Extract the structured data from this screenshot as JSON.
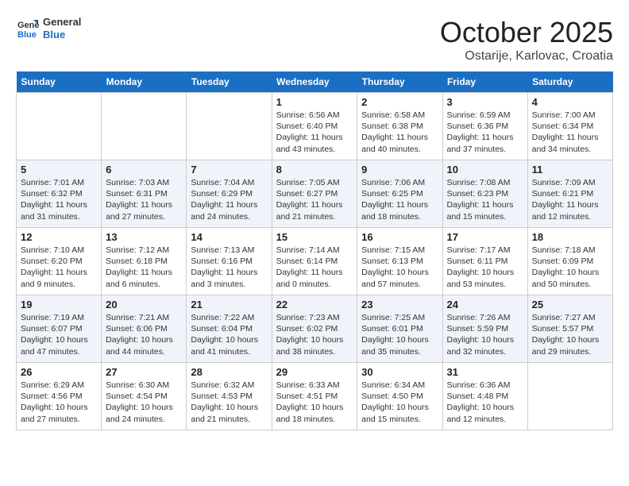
{
  "header": {
    "logo_line1": "General",
    "logo_line2": "Blue",
    "month": "October 2025",
    "location": "Ostarije, Karlovac, Croatia"
  },
  "weekdays": [
    "Sunday",
    "Monday",
    "Tuesday",
    "Wednesday",
    "Thursday",
    "Friday",
    "Saturday"
  ],
  "weeks": [
    [
      {
        "day": "",
        "info": ""
      },
      {
        "day": "",
        "info": ""
      },
      {
        "day": "",
        "info": ""
      },
      {
        "day": "1",
        "info": "Sunrise: 6:56 AM\nSunset: 6:40 PM\nDaylight: 11 hours and 43 minutes."
      },
      {
        "day": "2",
        "info": "Sunrise: 6:58 AM\nSunset: 6:38 PM\nDaylight: 11 hours and 40 minutes."
      },
      {
        "day": "3",
        "info": "Sunrise: 6:59 AM\nSunset: 6:36 PM\nDaylight: 11 hours and 37 minutes."
      },
      {
        "day": "4",
        "info": "Sunrise: 7:00 AM\nSunset: 6:34 PM\nDaylight: 11 hours and 34 minutes."
      }
    ],
    [
      {
        "day": "5",
        "info": "Sunrise: 7:01 AM\nSunset: 6:32 PM\nDaylight: 11 hours and 31 minutes."
      },
      {
        "day": "6",
        "info": "Sunrise: 7:03 AM\nSunset: 6:31 PM\nDaylight: 11 hours and 27 minutes."
      },
      {
        "day": "7",
        "info": "Sunrise: 7:04 AM\nSunset: 6:29 PM\nDaylight: 11 hours and 24 minutes."
      },
      {
        "day": "8",
        "info": "Sunrise: 7:05 AM\nSunset: 6:27 PM\nDaylight: 11 hours and 21 minutes."
      },
      {
        "day": "9",
        "info": "Sunrise: 7:06 AM\nSunset: 6:25 PM\nDaylight: 11 hours and 18 minutes."
      },
      {
        "day": "10",
        "info": "Sunrise: 7:08 AM\nSunset: 6:23 PM\nDaylight: 11 hours and 15 minutes."
      },
      {
        "day": "11",
        "info": "Sunrise: 7:09 AM\nSunset: 6:21 PM\nDaylight: 11 hours and 12 minutes."
      }
    ],
    [
      {
        "day": "12",
        "info": "Sunrise: 7:10 AM\nSunset: 6:20 PM\nDaylight: 11 hours and 9 minutes."
      },
      {
        "day": "13",
        "info": "Sunrise: 7:12 AM\nSunset: 6:18 PM\nDaylight: 11 hours and 6 minutes."
      },
      {
        "day": "14",
        "info": "Sunrise: 7:13 AM\nSunset: 6:16 PM\nDaylight: 11 hours and 3 minutes."
      },
      {
        "day": "15",
        "info": "Sunrise: 7:14 AM\nSunset: 6:14 PM\nDaylight: 11 hours and 0 minutes."
      },
      {
        "day": "16",
        "info": "Sunrise: 7:15 AM\nSunset: 6:13 PM\nDaylight: 10 hours and 57 minutes."
      },
      {
        "day": "17",
        "info": "Sunrise: 7:17 AM\nSunset: 6:11 PM\nDaylight: 10 hours and 53 minutes."
      },
      {
        "day": "18",
        "info": "Sunrise: 7:18 AM\nSunset: 6:09 PM\nDaylight: 10 hours and 50 minutes."
      }
    ],
    [
      {
        "day": "19",
        "info": "Sunrise: 7:19 AM\nSunset: 6:07 PM\nDaylight: 10 hours and 47 minutes."
      },
      {
        "day": "20",
        "info": "Sunrise: 7:21 AM\nSunset: 6:06 PM\nDaylight: 10 hours and 44 minutes."
      },
      {
        "day": "21",
        "info": "Sunrise: 7:22 AM\nSunset: 6:04 PM\nDaylight: 10 hours and 41 minutes."
      },
      {
        "day": "22",
        "info": "Sunrise: 7:23 AM\nSunset: 6:02 PM\nDaylight: 10 hours and 38 minutes."
      },
      {
        "day": "23",
        "info": "Sunrise: 7:25 AM\nSunset: 6:01 PM\nDaylight: 10 hours and 35 minutes."
      },
      {
        "day": "24",
        "info": "Sunrise: 7:26 AM\nSunset: 5:59 PM\nDaylight: 10 hours and 32 minutes."
      },
      {
        "day": "25",
        "info": "Sunrise: 7:27 AM\nSunset: 5:57 PM\nDaylight: 10 hours and 29 minutes."
      }
    ],
    [
      {
        "day": "26",
        "info": "Sunrise: 6:29 AM\nSunset: 4:56 PM\nDaylight: 10 hours and 27 minutes."
      },
      {
        "day": "27",
        "info": "Sunrise: 6:30 AM\nSunset: 4:54 PM\nDaylight: 10 hours and 24 minutes."
      },
      {
        "day": "28",
        "info": "Sunrise: 6:32 AM\nSunset: 4:53 PM\nDaylight: 10 hours and 21 minutes."
      },
      {
        "day": "29",
        "info": "Sunrise: 6:33 AM\nSunset: 4:51 PM\nDaylight: 10 hours and 18 minutes."
      },
      {
        "day": "30",
        "info": "Sunrise: 6:34 AM\nSunset: 4:50 PM\nDaylight: 10 hours and 15 minutes."
      },
      {
        "day": "31",
        "info": "Sunrise: 6:36 AM\nSunset: 4:48 PM\nDaylight: 10 hours and 12 minutes."
      },
      {
        "day": "",
        "info": ""
      }
    ]
  ]
}
